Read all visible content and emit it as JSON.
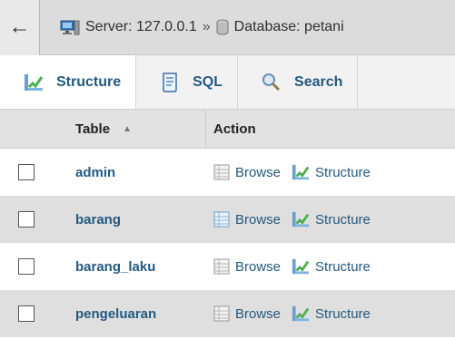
{
  "topbar": {
    "back_glyph": "←",
    "server_label": "Server: 127.0.0.1",
    "separator": "»",
    "database_label": "Database: petani"
  },
  "tabs": [
    {
      "label": "Structure",
      "icon": "structure-icon",
      "active": true
    },
    {
      "label": "SQL",
      "icon": "sql-icon",
      "active": false
    },
    {
      "label": "Search",
      "icon": "search-icon",
      "active": false
    }
  ],
  "table": {
    "headers": {
      "table": "Table",
      "action": "Action"
    },
    "sort_glyph": "▲",
    "rows": [
      {
        "name": "admin",
        "browse": "Browse",
        "structure": "Structure"
      },
      {
        "name": "barang",
        "browse": "Browse",
        "structure": "Structure"
      },
      {
        "name": "barang_laku",
        "browse": "Browse",
        "structure": "Structure"
      },
      {
        "name": "pengeluaran",
        "browse": "Browse",
        "structure": "Structure"
      }
    ]
  },
  "colors": {
    "link": "#235a81",
    "header_bg": "#e2e2e2",
    "topbar_bg": "#dcdcdc"
  }
}
